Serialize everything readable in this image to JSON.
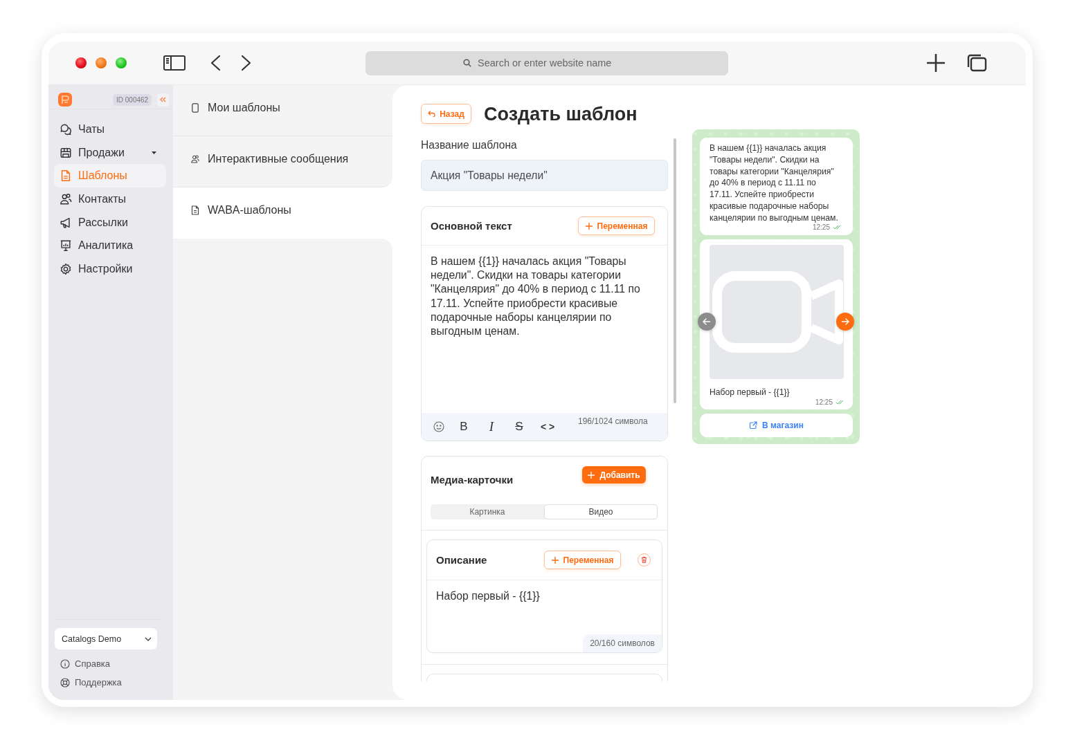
{
  "browser": {
    "address_placeholder": "Search or enter website name"
  },
  "sidebar": {
    "account_id": "ID 000462",
    "items": [
      {
        "label": "Чаты",
        "selected": false,
        "has_submenu": false
      },
      {
        "label": "Продажи",
        "selected": false,
        "has_submenu": true
      },
      {
        "label": "Шаблоны",
        "selected": true,
        "has_submenu": false
      },
      {
        "label": "Контакты",
        "selected": false,
        "has_submenu": false
      },
      {
        "label": "Рассылки",
        "selected": false,
        "has_submenu": false
      },
      {
        "label": "Аналитика",
        "selected": false,
        "has_submenu": false
      },
      {
        "label": "Настройки",
        "selected": false,
        "has_submenu": false
      }
    ],
    "workspace": "Catalogs Demo",
    "footer_links": [
      "Справка",
      "Поддержка"
    ]
  },
  "submenu": {
    "items": [
      {
        "label": "Мои шаблоны",
        "selected": false
      },
      {
        "label": "Интерактивные сообщения",
        "selected": false
      },
      {
        "label": "WABA-шаблоны",
        "selected": true
      }
    ]
  },
  "page": {
    "back_button": "Назад",
    "title": "Создать шаблон"
  },
  "form": {
    "name_label": "Название шаблона",
    "name_value": "Акция \"Товары недели\"",
    "body": {
      "title": "Основной текст",
      "variable_button": "Переменная",
      "text": "В нашем {{1}} началась акция \"Товары недели\". Скидки на товары категории \"Канцелярия\" до 40% в период с 11.11 по 17.11. Успейте приобрести красивые подарочные наборы канцелярии по выгодным ценам.",
      "toolbar": [
        {
          "kind": "emoji"
        },
        {
          "kind": "bold",
          "label": "B"
        },
        {
          "kind": "italic",
          "label": "I"
        },
        {
          "kind": "strike",
          "label": "S"
        },
        {
          "kind": "code",
          "label": "< >"
        }
      ],
      "counter": "196/1024 символа"
    },
    "media": {
      "title": "Медиа-карточки",
      "add_button": "Добавить",
      "media_types": [
        {
          "label": "Картинка",
          "selected": false
        },
        {
          "label": "Видео",
          "selected": true
        }
      ],
      "cards": [
        {
          "title": "Описание",
          "variable_button": "Переменная",
          "text": "Набор первый - {{1}}",
          "counter": "20/160 символов"
        }
      ]
    }
  },
  "preview": {
    "message": {
      "text": "В нашем {{1}} началась акция \"Товары недели\". Скидки на товары категории \"Канцелярия\" до 40% в период с 11.11 по 17.11. Успейте приобрести красивые подарочные наборы канцелярии по выгодным ценам.",
      "time": "12:25"
    },
    "card": {
      "caption": "Набор первый - {{1}}",
      "time": "12:25",
      "prev_enabled": false,
      "next_enabled": true
    },
    "button": "В магазин"
  }
}
